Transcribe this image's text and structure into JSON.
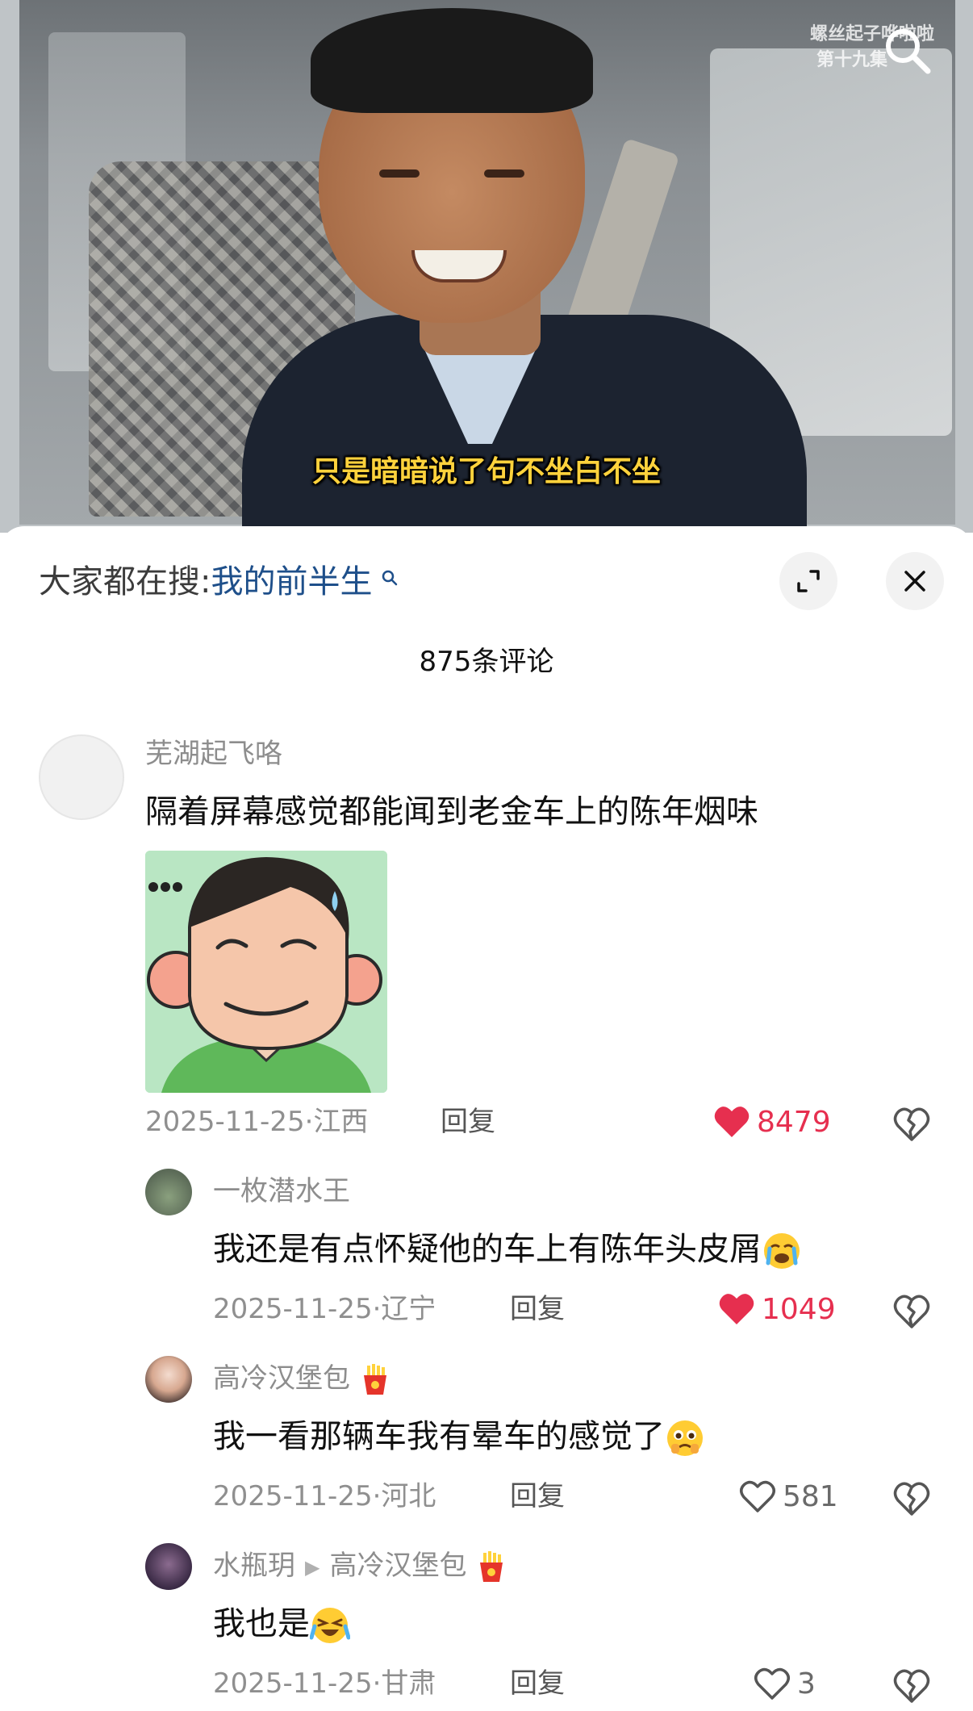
{
  "video": {
    "subtitle": "只是暗暗说了句不坐白不坐",
    "watermark_line1": "螺丝起子哗啦啦",
    "watermark_line2": "第十九集"
  },
  "sheet": {
    "search_prefix": "大家都在搜:",
    "search_term": "我的前半生",
    "comment_count": "875条评论"
  },
  "comments": [
    {
      "user": "芜湖起飞咯",
      "text": "隔着屏幕感觉都能闻到老金车上的陈年烟味",
      "date_location": "2025-11-25·江西",
      "reply_label": "回复",
      "likes": "8479",
      "liked": true
    },
    {
      "user": "一枚潜水王",
      "text": "我还是有点怀疑他的车上有陈年头皮屑",
      "date_location": "2025-11-25·辽宁",
      "reply_label": "回复",
      "likes": "1049",
      "liked": true
    },
    {
      "user": "高冷汉堡包",
      "text": "我一看那辆车我有晕车的感觉了",
      "date_location": "2025-11-25·河北",
      "reply_label": "回复",
      "likes": "581",
      "liked": false
    },
    {
      "user": "水瓶玥",
      "reply_to": "高冷汉堡包",
      "text": "我也是",
      "date_location": "2025-11-25·甘肃",
      "reply_label": "回复",
      "likes": "3",
      "liked": false
    }
  ],
  "colors": {
    "like_active": "#e62f4f",
    "link": "#1e4f8a",
    "meta_gray": "#8f8f8f"
  }
}
